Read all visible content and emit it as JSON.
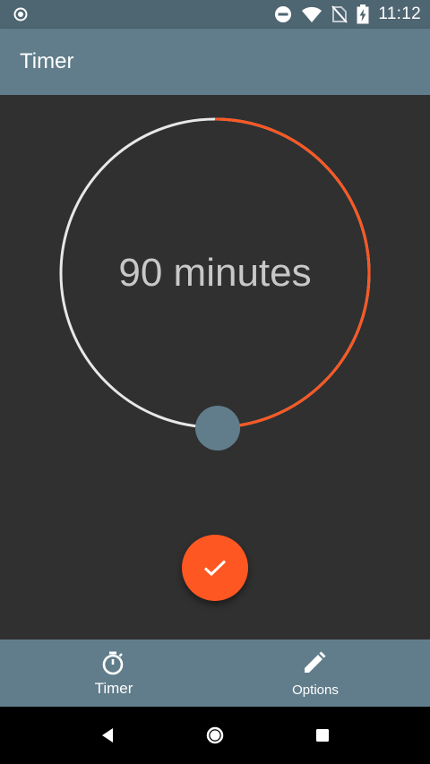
{
  "status_bar": {
    "time": "11:12",
    "left_icon": "record-icon",
    "right_icons": [
      "do-not-disturb-icon",
      "wifi-icon",
      "no-sim-icon",
      "battery-charging-icon"
    ]
  },
  "app_bar": {
    "title": "Timer"
  },
  "timer": {
    "value_label": "90 minutes",
    "progress_fraction": 0.5,
    "colors": {
      "track": "#e8e8e8",
      "progress": "#ff5722",
      "handle": "#617d8b"
    }
  },
  "fab": {
    "icon": "check-icon",
    "color": "#ff5722"
  },
  "bottom_nav": {
    "items": [
      {
        "label": "Timer",
        "icon": "stopwatch-icon",
        "active": true
      },
      {
        "label": "Options",
        "icon": "pencil-icon",
        "active": false
      }
    ]
  },
  "system_nav": {
    "buttons": [
      "back-icon",
      "home-icon",
      "recents-icon"
    ]
  },
  "colors": {
    "status_bar": "#4e6572",
    "app_bar": "#617d8b",
    "background": "#303030",
    "accent": "#ff5722"
  }
}
